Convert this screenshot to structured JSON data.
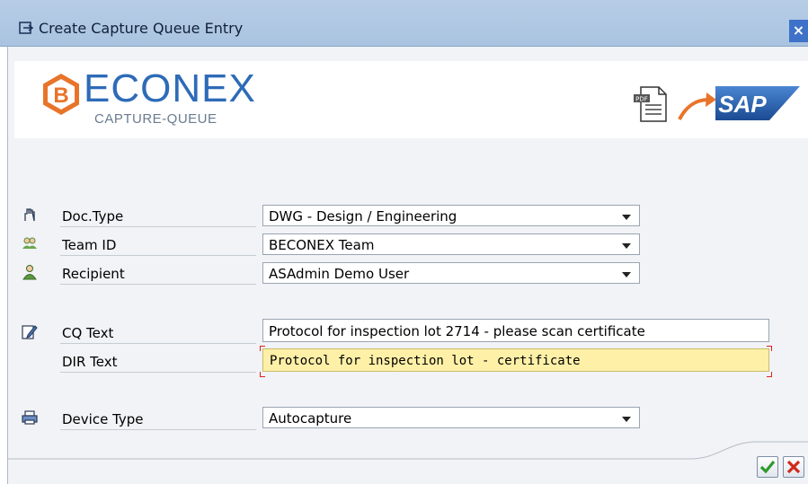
{
  "window": {
    "title": "Create Capture Queue Entry",
    "close_glyph": "×"
  },
  "banner": {
    "logo_text": "ECONEX",
    "logo_subtitle": "CAPTURE-QUEUE",
    "pdf_badge": "PDF",
    "sap_text": "SAP"
  },
  "form": {
    "doc_type": {
      "label": "Doc.Type",
      "value": "DWG - Design / Engineering",
      "icon": "hand-icon"
    },
    "team_id": {
      "label": "Team ID",
      "value": "BECONEX Team",
      "icon": "team-icon"
    },
    "recipient": {
      "label": "Recipient",
      "value": "ASAdmin Demo User",
      "icon": "user-icon"
    },
    "cq_text": {
      "label": "CQ Text",
      "value": "Protocol for inspection lot 2714 - please scan certificate",
      "icon": "edit-icon"
    },
    "dir_text": {
      "label": "DIR Text",
      "value": "Protocol for inspection lot - certificate"
    },
    "device_type": {
      "label": "Device Type",
      "value": "Autocapture",
      "icon": "printer-icon"
    }
  },
  "buttons": {
    "confirm_icon": "checkmark-icon",
    "cancel_icon": "cancel-icon"
  },
  "colors": {
    "title_bar": "#b7cde6",
    "logo_orange": "#e8742a",
    "logo_blue": "#2e6bb8",
    "readonly_field": "#fff0a8",
    "sap_blue": "#2b5ea7"
  }
}
